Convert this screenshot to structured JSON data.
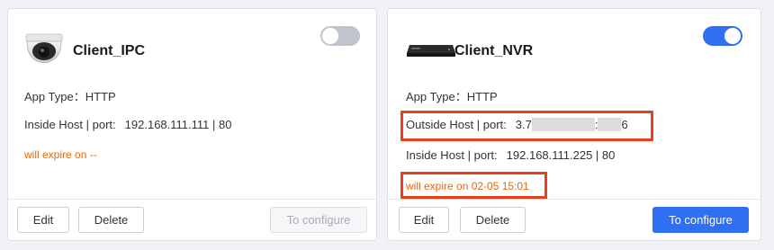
{
  "cards": [
    {
      "title": "Client_IPC",
      "device_icon": "dome-camera-icon",
      "toggle_on": false,
      "app_type_label": "App Type：",
      "app_type_value": "HTTP",
      "inside_host_label": "Inside Host | port:",
      "inside_host_value": "192.168.111.111 | 80",
      "expire_text": "will expire on --",
      "buttons": {
        "edit": "Edit",
        "delete": "Delete",
        "configure": "To configure"
      },
      "configure_enabled": false
    },
    {
      "title": "Client_NVR",
      "device_icon": "nvr-recorder-icon",
      "toggle_on": true,
      "app_type_label": "App Type：",
      "app_type_value": "HTTP",
      "outside_host_label": "Outside Host | port:",
      "outside_host_prefix": "3.7",
      "outside_host_sep": ":",
      "outside_host_suffix": "6",
      "inside_host_label": "Inside Host | port:",
      "inside_host_value": "192.168.111.225 | 80",
      "expire_text": "will expire on 02-05 15:01",
      "buttons": {
        "edit": "Edit",
        "delete": "Delete",
        "configure": "To configure"
      },
      "configure_enabled": true
    }
  ],
  "colors": {
    "accent": "#2f6ff0",
    "expire": "#e8670c",
    "highlight": "#e8401c",
    "toggle_off": "#c0c4cc"
  }
}
